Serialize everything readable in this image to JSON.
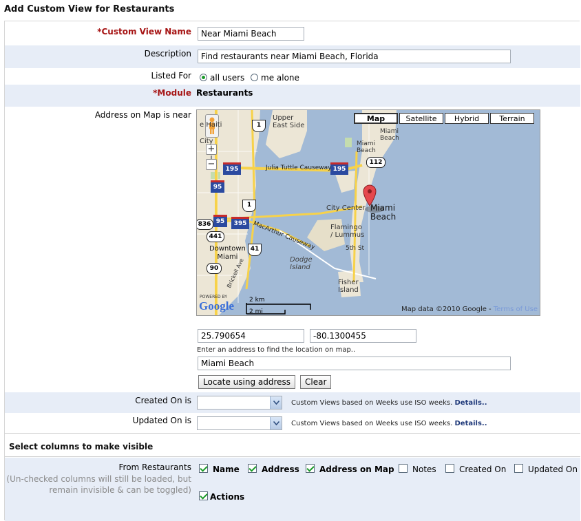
{
  "page": {
    "title": "Add Custom View for Restaurants"
  },
  "form": {
    "custom_view_name": {
      "required_mark": "*",
      "label": "Custom View Name",
      "value": "Near Miami Beach"
    },
    "description": {
      "label": "Description",
      "value": "Find restaurants near Miami Beach, Florida"
    },
    "listed_for": {
      "label": "Listed For",
      "options": [
        "all users",
        "me alone"
      ],
      "selected": "all users"
    },
    "module": {
      "required_mark": "*",
      "label": "Module",
      "value": "Restaurants"
    },
    "address_on_map": {
      "label": "Address on Map is near",
      "latitude": "25.790654",
      "longitude": "-80.1300455",
      "hint": "Enter an address to find the location on map..",
      "address": "Miami Beach",
      "locate_button": "Locate using address",
      "clear_button": "Clear"
    },
    "created_on": {
      "label": "Created On is",
      "value": "",
      "hint": "Custom Views based on Weeks use ISO weeks.",
      "details": "Details.."
    },
    "updated_on": {
      "label": "Updated On is",
      "value": "",
      "hint": "Custom Views based on Weeks use ISO weeks.",
      "details": "Details.."
    }
  },
  "map": {
    "types": [
      "Map",
      "Satellite",
      "Hybrid",
      "Terrain"
    ],
    "active_type": "Map",
    "zoom_in": "+",
    "zoom_out": "−",
    "labels": {
      "upper_east_side": [
        "Upper",
        "East Side"
      ],
      "little_haiti": "e Haiti",
      "city": "City",
      "miami_beach_small": [
        "Miami",
        "Beach"
      ],
      "miami_beach_top": [
        "Miami",
        "Beach"
      ],
      "julia_tuttle": "Julia Tuttle Causeway",
      "city_center": "City Center",
      "miami_beach_big": [
        "Miami",
        "Beach"
      ],
      "macarthur": "MacArthur Causeway",
      "flamingo": [
        "Flamingo",
        "/ Lummus"
      ],
      "fifth_st": "5th St",
      "downtown": [
        "Downtown",
        "Miami"
      ],
      "dodge": [
        "Dodge",
        "Island"
      ],
      "fisher": [
        "Fisher",
        "Island"
      ],
      "brickell": "Brickell Ave",
      "powered": "POWERED BY",
      "google": "Google"
    },
    "shields": [
      "1",
      "1",
      "195",
      "195",
      "112",
      "95",
      "95",
      "395",
      "836",
      "441",
      "41",
      "90"
    ],
    "scale_km": "2 km",
    "scale_mi": "2 mi",
    "attribution": "Map data ©2010 Google -",
    "terms": "Terms of Use"
  },
  "columns": {
    "section_title": "Select columns to make visible",
    "from_label": "From Restaurants",
    "note": [
      "(Un-checked columns will still be loaded, but",
      "remain invisible & can be toggled)"
    ],
    "items": [
      {
        "label": "Name",
        "checked": true
      },
      {
        "label": "Address",
        "checked": true
      },
      {
        "label": "Address on Map",
        "checked": true
      },
      {
        "label": "Notes",
        "checked": false
      },
      {
        "label": "Created On",
        "checked": false
      },
      {
        "label": "Updated On",
        "checked": false
      },
      {
        "label": "Actions",
        "checked": true
      }
    ]
  },
  "colors": {
    "required": "#a61414",
    "band": "#e7edf7",
    "water": "#a2bad6",
    "land": "#ece6d6",
    "link": "#203a7a",
    "check": "#1a9a28"
  }
}
